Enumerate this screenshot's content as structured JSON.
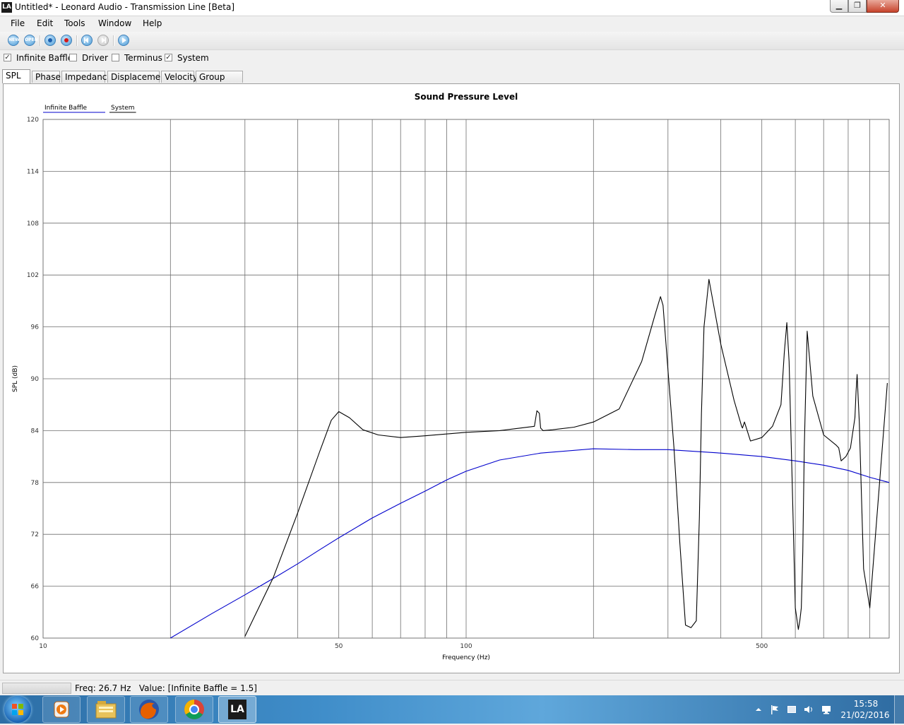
{
  "window": {
    "logo_text": "LA",
    "title": "Untitled* - Leonard Audio - Transmission Line [Beta]",
    "min_glyph": "▁",
    "max_glyph": "❐",
    "close_glyph": "✕"
  },
  "menu": [
    "File",
    "Edit",
    "Tools",
    "Window",
    "Help"
  ],
  "toolbar": {
    "new_label": "NEW",
    "open_label": "OPEN"
  },
  "checkboxes": [
    {
      "label": "Infinite Baffle",
      "checked": true
    },
    {
      "label": "Driver",
      "checked": false
    },
    {
      "label": "Terminus",
      "checked": false
    },
    {
      "label": "System",
      "checked": true
    }
  ],
  "check_glyph": "✓",
  "tabs": [
    {
      "label": "SPL",
      "active": true
    },
    {
      "label": "Phase",
      "active": false
    },
    {
      "label": "Impedance",
      "active": false
    },
    {
      "label": "Displacement",
      "active": false
    },
    {
      "label": "Velocity",
      "active": false
    },
    {
      "label": "Group Delay",
      "active": false
    }
  ],
  "chart_data": {
    "type": "line",
    "title": "Sound Pressure Level",
    "xlabel": "Frequency (Hz)",
    "ylabel": "SPL (dB)",
    "x_scale": "log",
    "xlim": [
      10,
      1000
    ],
    "ylim": [
      60,
      120
    ],
    "x_tick_labels": [
      10,
      50,
      100,
      500
    ],
    "x_grid": [
      10,
      20,
      30,
      40,
      50,
      60,
      70,
      80,
      90,
      100,
      200,
      300,
      400,
      500,
      600,
      700,
      800,
      900,
      1000
    ],
    "y_ticks": [
      60,
      66,
      72,
      78,
      84,
      90,
      96,
      102,
      108,
      114,
      120
    ],
    "grid": true,
    "legend_position": "top-left",
    "series": [
      {
        "name": "Infinite Baffle",
        "color": "#0000cc",
        "x": [
          20,
          25,
          30,
          35,
          40,
          45,
          50,
          60,
          70,
          80,
          90,
          100,
          120,
          150,
          200,
          250,
          300,
          400,
          500,
          600,
          700,
          800,
          900,
          1000
        ],
        "y": [
          60,
          62.8,
          65.0,
          66.9,
          68.6,
          70.2,
          71.6,
          73.9,
          75.6,
          77.0,
          78.3,
          79.3,
          80.6,
          81.4,
          81.9,
          81.8,
          81.8,
          81.4,
          81.0,
          80.5,
          80.0,
          79.4,
          78.6,
          78.0
        ]
      },
      {
        "name": "System",
        "color": "#000000",
        "x": [
          30,
          35,
          40,
          45,
          48,
          50,
          53,
          57,
          62,
          70,
          80,
          100,
          120,
          145,
          147,
          149,
          150,
          152,
          160,
          180,
          200,
          230,
          260,
          280,
          288,
          292,
          300,
          310,
          320,
          330,
          340,
          350,
          356,
          360,
          365,
          375,
          400,
          430,
          448,
          450,
          455,
          470,
          500,
          530,
          555,
          560,
          565,
          573,
          580,
          590,
          600,
          610,
          615,
          620,
          625,
          630,
          640,
          660,
          700,
          750,
          760,
          770,
          790,
          810,
          830,
          835,
          840,
          850,
          870,
          900,
          990
        ],
        "y": [
          60.2,
          67.0,
          74.5,
          81.5,
          85.2,
          86.2,
          85.5,
          84.1,
          83.5,
          83.2,
          83.4,
          83.8,
          84.0,
          84.5,
          86.3,
          86.0,
          84.3,
          84.0,
          84.1,
          84.4,
          85.0,
          86.5,
          92.0,
          97.5,
          99.5,
          98.5,
          91.0,
          82.0,
          71.0,
          61.5,
          61.2,
          62.0,
          74.0,
          86.0,
          96.0,
          101.5,
          94.0,
          87.5,
          84.5,
          84.3,
          85.0,
          82.8,
          83.2,
          84.5,
          87.0,
          90.0,
          93.0,
          96.5,
          92.0,
          78.0,
          63.5,
          61.0,
          62.0,
          63.5,
          70.0,
          82.0,
          95.5,
          88.0,
          83.5,
          82.3,
          82.0,
          80.5,
          81.0,
          82.0,
          85.5,
          88.5,
          90.5,
          85.0,
          68.0,
          63.5,
          89.5
        ]
      }
    ]
  },
  "status": {
    "text": "Freq: 26.7 Hz   Value: [Infinite Baffle = 1.5]"
  },
  "taskbar": {
    "apps": [
      "media-player",
      "file-explorer",
      "firefox",
      "chrome",
      "leonard-audio"
    ],
    "active_app": "leonard-audio",
    "app_logo_text": "LA",
    "time": "15:58",
    "date": "21/02/2016"
  }
}
